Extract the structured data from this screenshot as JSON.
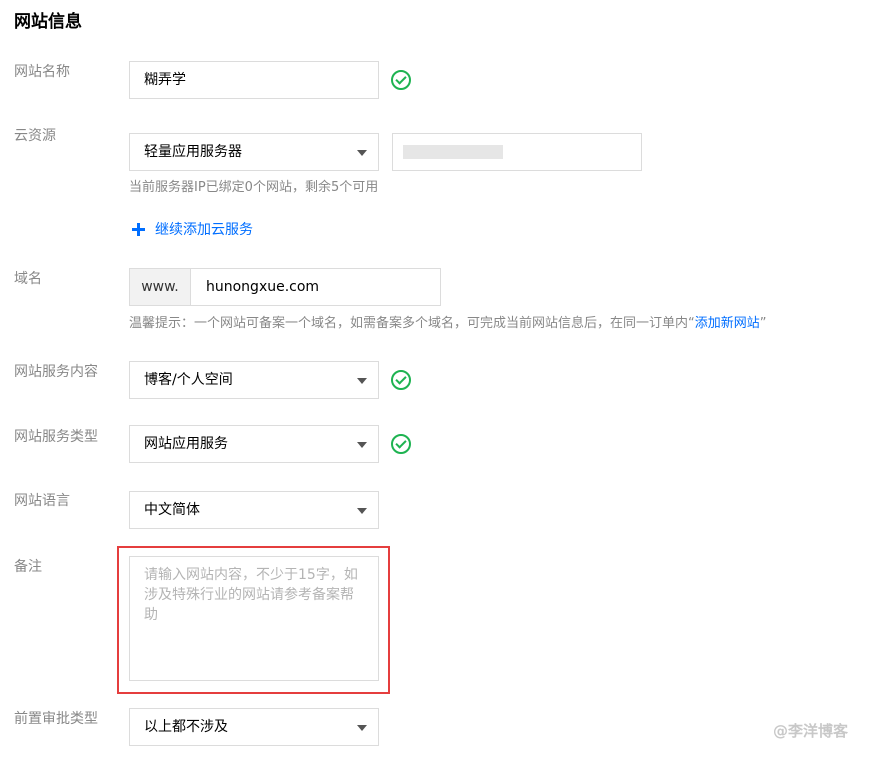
{
  "section_title": "网站信息",
  "colors": {
    "accent": "#006eff",
    "success": "#1eb351",
    "highlight": "#e53e3e"
  },
  "fields": {
    "site_name": {
      "label": "网站名称",
      "value": "糊弄学",
      "status_icon": "check-circle-icon"
    },
    "cloud_resource": {
      "label": "云资源",
      "select_value": "轻量应用服务器",
      "ip_hint": "当前服务器IP已绑定0个网站，剩余5个可用",
      "add_more": "继续添加云服务"
    },
    "domain": {
      "label": "域名",
      "prefix": "www.",
      "value": "hunongxue.com",
      "hint_before": "温馨提示：一个网站可备案一个域名，如需备案多个域名，可完成当前网站信息后，在同一订单内“",
      "hint_link": "添加新网站",
      "hint_after": "”"
    },
    "service_content": {
      "label": "网站服务内容",
      "value": "博客/个人空间",
      "status_icon": "check-circle-icon"
    },
    "service_type": {
      "label": "网站服务类型",
      "value": "网站应用服务",
      "status_icon": "check-circle-icon"
    },
    "language": {
      "label": "网站语言",
      "value": "中文简体"
    },
    "remark": {
      "label": "备注",
      "placeholder": "请输入网站内容，不少于15字，如涉及特殊行业的网站请参考备案帮助"
    },
    "pre_approval": {
      "label": "前置审批类型",
      "value": "以上都不涉及"
    }
  },
  "watermark": "@李洋博客"
}
